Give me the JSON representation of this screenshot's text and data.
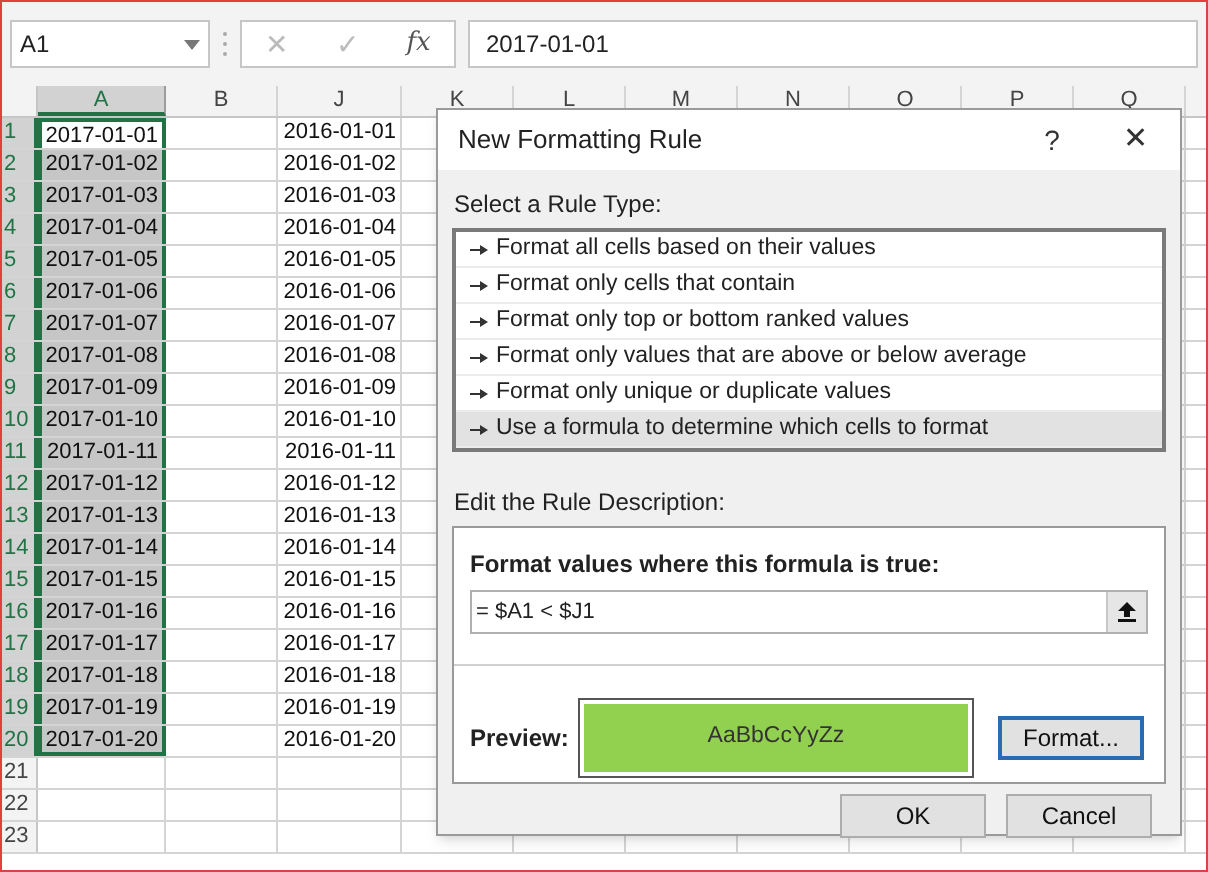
{
  "name_box": "A1",
  "formula_bar": {
    "cancel": "✕",
    "enter": "✓",
    "function": "fx",
    "value": "2017-01-01"
  },
  "columns": [
    {
      "label": "A",
      "selected": true
    },
    {
      "label": "B",
      "selected": false
    },
    {
      "label": "J",
      "selected": false
    },
    {
      "label": "K",
      "selected": false
    },
    {
      "label": "L",
      "selected": false
    },
    {
      "label": "M",
      "selected": false
    },
    {
      "label": "N",
      "selected": false
    },
    {
      "label": "O",
      "selected": false
    },
    {
      "label": "P",
      "selected": false
    },
    {
      "label": "Q",
      "selected": false
    }
  ],
  "rows": [
    {
      "number": "1",
      "a": "2017-01-01",
      "j": "2016-01-01",
      "selected": true,
      "active": true
    },
    {
      "number": "2",
      "a": "2017-01-02",
      "j": "2016-01-02",
      "selected": true,
      "active": false
    },
    {
      "number": "3",
      "a": "2017-01-03",
      "j": "2016-01-03",
      "selected": true,
      "active": false
    },
    {
      "number": "4",
      "a": "2017-01-04",
      "j": "2016-01-04",
      "selected": true,
      "active": false
    },
    {
      "number": "5",
      "a": "2017-01-05",
      "j": "2016-01-05",
      "selected": true,
      "active": false
    },
    {
      "number": "6",
      "a": "2017-01-06",
      "j": "2016-01-06",
      "selected": true,
      "active": false
    },
    {
      "number": "7",
      "a": "2017-01-07",
      "j": "2016-01-07",
      "selected": true,
      "active": false
    },
    {
      "number": "8",
      "a": "2017-01-08",
      "j": "2016-01-08",
      "selected": true,
      "active": false
    },
    {
      "number": "9",
      "a": "2017-01-09",
      "j": "2016-01-09",
      "selected": true,
      "active": false
    },
    {
      "number": "10",
      "a": "2017-01-10",
      "j": "2016-01-10",
      "selected": true,
      "active": false
    },
    {
      "number": "11",
      "a": "2017-01-11",
      "j": "2016-01-11",
      "selected": true,
      "active": false
    },
    {
      "number": "12",
      "a": "2017-01-12",
      "j": "2016-01-12",
      "selected": true,
      "active": false
    },
    {
      "number": "13",
      "a": "2017-01-13",
      "j": "2016-01-13",
      "selected": true,
      "active": false
    },
    {
      "number": "14",
      "a": "2017-01-14",
      "j": "2016-01-14",
      "selected": true,
      "active": false
    },
    {
      "number": "15",
      "a": "2017-01-15",
      "j": "2016-01-15",
      "selected": true,
      "active": false
    },
    {
      "number": "16",
      "a": "2017-01-16",
      "j": "2016-01-16",
      "selected": true,
      "active": false
    },
    {
      "number": "17",
      "a": "2017-01-17",
      "j": "2016-01-17",
      "selected": true,
      "active": false
    },
    {
      "number": "18",
      "a": "2017-01-18",
      "j": "2016-01-18",
      "selected": true,
      "active": false
    },
    {
      "number": "19",
      "a": "2017-01-19",
      "j": "2016-01-19",
      "selected": true,
      "active": false
    },
    {
      "number": "20",
      "a": "2017-01-20",
      "j": "2016-01-20",
      "selected": true,
      "active": false
    },
    {
      "number": "21",
      "selected": false,
      "active": false
    },
    {
      "number": "22",
      "selected": false,
      "active": false
    },
    {
      "number": "23",
      "selected": false,
      "active": false
    }
  ],
  "dialog": {
    "title": "New Formatting Rule",
    "help": "?",
    "close": "✕",
    "rule_type_label": "Select a Rule Type:",
    "rule_types": [
      {
        "label": "Format all cells based on their values",
        "selected": false
      },
      {
        "label": "Format only cells that contain",
        "selected": false
      },
      {
        "label": "Format only top or bottom ranked values",
        "selected": false
      },
      {
        "label": "Format only values that are above or below average",
        "selected": false
      },
      {
        "label": "Format only unique or duplicate values",
        "selected": false
      },
      {
        "label": "Use a formula to determine which cells to format",
        "selected": true
      }
    ],
    "description_label": "Edit the Rule Description:",
    "formula_label": "Format values where this formula is true:",
    "formula": "= $A1 < $J1",
    "preview_label": "Preview:",
    "preview_text": "AaBbCcYyZz",
    "format_button": "Format...",
    "ok_button": "OK",
    "cancel_button": "Cancel"
  }
}
